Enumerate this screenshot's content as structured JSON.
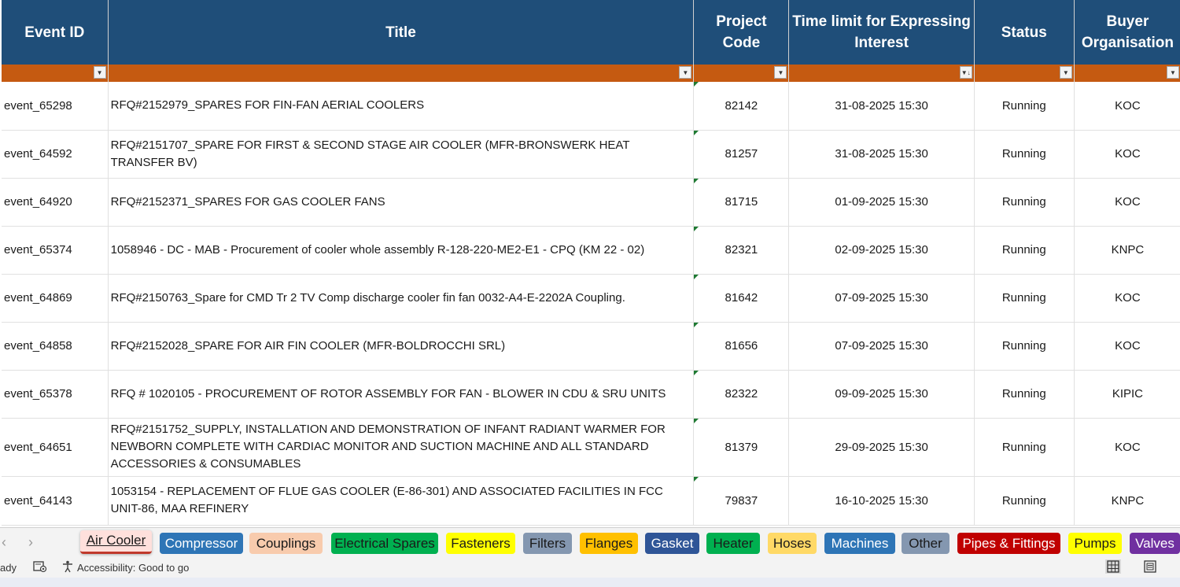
{
  "headers": {
    "event_id": "Event ID",
    "title": "Title",
    "project_code": "Project Code",
    "time_limit": "Time limit for Expressing Interest",
    "status": "Status",
    "buyer": "Buyer Organisation"
  },
  "rows": [
    {
      "event_id": "event_65298",
      "title": "RFQ#2152979_SPARES FOR FIN-FAN AERIAL COOLERS",
      "code": "82142",
      "time": "31-08-2025 15:30",
      "status": "Running",
      "buyer": "KOC"
    },
    {
      "event_id": "event_64592",
      "title": "RFQ#2151707_SPARE FOR FIRST & SECOND STAGE AIR COOLER (MFR-BRONSWERK HEAT TRANSFER BV)",
      "code": "81257",
      "time": "31-08-2025 15:30",
      "status": "Running",
      "buyer": "KOC"
    },
    {
      "event_id": "event_64920",
      "title": "RFQ#2152371_SPARES FOR GAS COOLER FANS",
      "code": "81715",
      "time": "01-09-2025 15:30",
      "status": "Running",
      "buyer": "KOC"
    },
    {
      "event_id": "event_65374",
      "title": "1058946 - DC - MAB - Procurement of cooler whole assembly R-128-220-ME2-E1 - CPQ (KM 22 - 02)",
      "code": "82321",
      "time": "02-09-2025 15:30",
      "status": "Running",
      "buyer": "KNPC"
    },
    {
      "event_id": "event_64869",
      "title": "RFQ#2150763_Spare for CMD Tr 2 TV Comp discharge cooler fin fan 0032-A4-E-2202A Coupling.",
      "code": "81642",
      "time": "07-09-2025 15:30",
      "status": "Running",
      "buyer": "KOC"
    },
    {
      "event_id": "event_64858",
      "title": "RFQ#2152028_SPARE FOR AIR FIN COOLER (MFR-BOLDROCCHI SRL)",
      "code": "81656",
      "time": "07-09-2025 15:30",
      "status": "Running",
      "buyer": "KOC"
    },
    {
      "event_id": "event_65378",
      "title": "RFQ # 1020105 - PROCUREMENT OF ROTOR ASSEMBLY FOR FAN - BLOWER IN CDU & SRU UNITS",
      "code": "82322",
      "time": "09-09-2025 15:30",
      "status": "Running",
      "buyer": "KIPIC"
    },
    {
      "event_id": "event_64651",
      "title": "RFQ#2151752_SUPPLY, INSTALLATION AND DEMONSTRATION OF INFANT RADIANT WARMER FOR NEWBORN COMPLETE WITH CARDIAC MONITOR AND SUCTION MACHINE AND ALL STANDARD ACCESSORIES & CONSUMABLES",
      "code": "81379",
      "time": "29-09-2025 15:30",
      "status": "Running",
      "buyer": "KOC"
    },
    {
      "event_id": "event_64143",
      "title": "1053154 - REPLACEMENT OF FLUE GAS COOLER (E-86-301) AND ASSOCIATED FACILITIES IN FCC UNIT-86, MAA REFINERY",
      "code": "79837",
      "time": "16-10-2025 15:30",
      "status": "Running",
      "buyer": "KNPC"
    }
  ],
  "tabs": [
    {
      "label": "Air Cooler",
      "bg": "#ffe0dc",
      "fg": "#1a1a1a",
      "active": true
    },
    {
      "label": "Compressor",
      "bg": "#2e75b6",
      "fg": "#ffffff"
    },
    {
      "label": "Couplings",
      "bg": "#f8cbad",
      "fg": "#1a1a1a"
    },
    {
      "label": "Electrical Spares",
      "bg": "#00b050",
      "fg": "#1a1a1a"
    },
    {
      "label": "Fasteners",
      "bg": "#ffff00",
      "fg": "#1a1a1a"
    },
    {
      "label": "Filters",
      "bg": "#8497b0",
      "fg": "#1a1a1a"
    },
    {
      "label": "Flanges",
      "bg": "#ffc000",
      "fg": "#1a1a1a"
    },
    {
      "label": "Gasket",
      "bg": "#2f5597",
      "fg": "#ffffff"
    },
    {
      "label": "Heater",
      "bg": "#00b050",
      "fg": "#1a1a1a"
    },
    {
      "label": "Hoses",
      "bg": "#ffd966",
      "fg": "#1a1a1a"
    },
    {
      "label": "Machines",
      "bg": "#2e75b6",
      "fg": "#ffffff"
    },
    {
      "label": "Other",
      "bg": "#8497b0",
      "fg": "#1a1a1a"
    },
    {
      "label": "Pipes & Fittings",
      "bg": "#c00000",
      "fg": "#ffffff"
    },
    {
      "label": "Pumps",
      "bg": "#ffff00",
      "fg": "#1a1a1a"
    },
    {
      "label": "Valves",
      "bg": "#7030a0",
      "fg": "#ffffff"
    }
  ],
  "statusbar": {
    "ready": "ady",
    "accessibility": "Accessibility: Good to go"
  },
  "colors": {
    "header_bg": "#1f4e79",
    "filter_bg": "#c55a11",
    "indicator": "#1e7a32"
  },
  "icons": {
    "filter_dropdown": "filter-dropdown-icon",
    "sort_filter": "sort-filter-icon",
    "nav_prev": "chevron-left-icon",
    "nav_next": "chevron-right-icon",
    "macro": "macro-record-icon",
    "accessibility": "accessibility-icon",
    "normal_view": "grid-view-icon",
    "page_layout": "page-layout-icon"
  }
}
